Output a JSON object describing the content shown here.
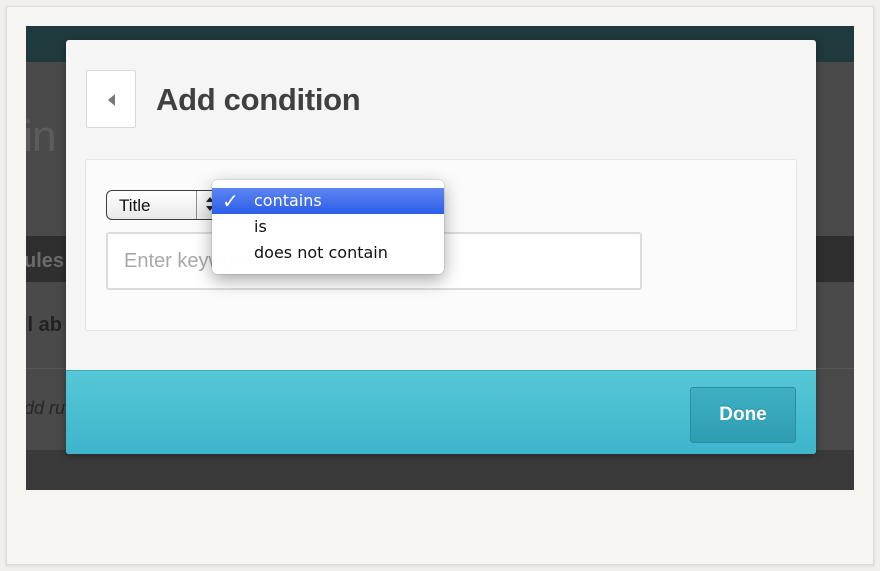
{
  "background": {
    "heading_fragment": "tin",
    "strip_label_fragment": "ules",
    "row_label_fragment": "ll ab",
    "footer_label_fragment": "dd ru"
  },
  "modal": {
    "title": "Add condition",
    "back_icon": "chevron-left-icon",
    "field_select": {
      "value": "Title"
    },
    "keyword_input": {
      "placeholder": "Enter keyword",
      "value": ""
    },
    "dropdown": {
      "options": [
        {
          "label": "contains",
          "selected": true
        },
        {
          "label": "is",
          "selected": false
        },
        {
          "label": "does not contain",
          "selected": false
        }
      ],
      "check_icon": "checkmark-icon"
    },
    "footer": {
      "done_label": "Done"
    }
  },
  "colors": {
    "footer_accent": "#4dbfd2",
    "done_button": "#3aa6bb",
    "dropdown_selection": "#3a6ae9",
    "title_text": "#404040"
  }
}
